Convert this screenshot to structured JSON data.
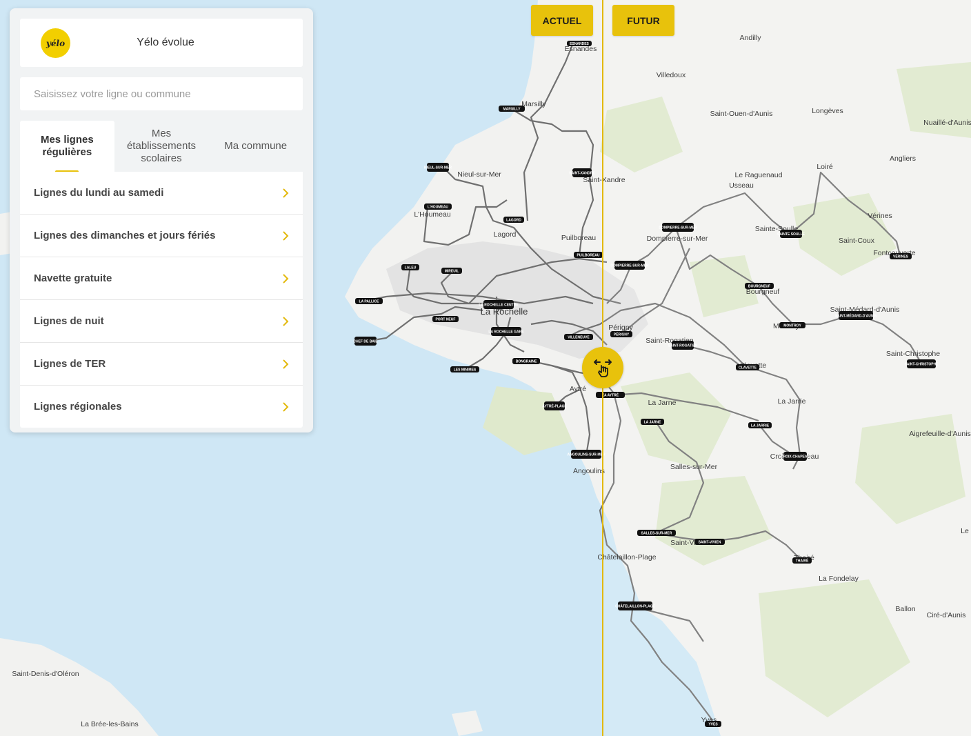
{
  "panel": {
    "logo_text": "yélo",
    "title": "Yélo évolue",
    "search": {
      "placeholder": "Saisissez votre ligne ou commune",
      "value": ""
    },
    "tabs": [
      {
        "label": "Mes lignes régulières",
        "active": true
      },
      {
        "label": "Mes établissements scolaires",
        "active": false
      },
      {
        "label": "Ma commune",
        "active": false
      }
    ],
    "menu": [
      {
        "label": "Lignes du lundi au samedi"
      },
      {
        "label": "Lignes des dimanches et jours fériés"
      },
      {
        "label": "Navette gratuite"
      },
      {
        "label": "Lignes de nuit"
      },
      {
        "label": "Lignes de TER"
      },
      {
        "label": "Lignes régionales"
      }
    ]
  },
  "compare": {
    "left_label": "ACTUEL",
    "right_label": "FUTUR"
  },
  "colors": {
    "accent": "#e8c20c",
    "sea": "#cfe7f5",
    "land": "#f2f2f0",
    "route": "#6e6e6e"
  },
  "map": {
    "place_labels": [
      "Esnandes",
      "Marsilly",
      "Nieul-sur-Mer",
      "L'Houmeau",
      "Lagord",
      "Puilboreau",
      "Saint-Xandre",
      "Villedoux",
      "Andilly",
      "Saint-Ouen-d'Aunis",
      "Longèves",
      "Nuaillé-d'Aunis",
      "Angliers",
      "Le Raguenaud",
      "Usseau",
      "Loiré",
      "Vérines",
      "Sainte-Soulle",
      "Saint-Coux",
      "Fontcouverte",
      "Dompierre-sur-Mer",
      "Bourgneuf",
      "Montroy",
      "Saint-Médard-d'Aunis",
      "Saint-Christophe",
      "La Rochelle",
      "Périgny",
      "Saint-Rogatien",
      "Clavette",
      "La Jarrie",
      "Aytré",
      "La Jarne",
      "Aigrefeuille-d'Aunis",
      "Croix-Chapeau",
      "Angoulins",
      "Salles-sur-Mer",
      "Saint-Vivien",
      "Châtelaillon-Plage",
      "Thairé",
      "La Fondelay",
      "Ballon",
      "Ciré-d'Aunis",
      "Yves",
      "Saint-Denis-d'Oléron",
      "La Brée-les-Bains",
      "Le"
    ],
    "stop_labels": [
      "ESNANDES",
      "MARSILLY",
      "NIEUL-SUR-MER",
      "SAINT-XANDRE",
      "L'HOUMEAU",
      "LAGORD",
      "LALEU",
      "MIREUIL",
      "LA PALLICE",
      "PORT NEUF",
      "LA ROCHELLE CENTRE",
      "LA ROCHELLE GARE",
      "CHEF DE BAIE",
      "LES MINIMES",
      "BONGRAINE",
      "VILLENEUVE",
      "PUILBOREAU",
      "DOMPIERRE-SUR-MER",
      "PÉRIGNY",
      "SAINT-ROGATIEN",
      "ZA AYTRÉ",
      "AYTRÉ-PLAGE",
      "ANGOULINS-SUR-MER",
      "LA JARNE",
      "SAINTE SOULLE",
      "VÉRINES",
      "BOURGNEUF",
      "MONTROY",
      "SAINT-MÉDARD-D'AUNIS",
      "SAINT-CHRISTOPHE",
      "CLAVETTE",
      "LA JARRIE",
      "CROIX-CHAPEAU",
      "SALLES-SUR-MER",
      "SAINT-VIVIEN",
      "THAIRÉ",
      "CHÂTELAILLON-PLAGE",
      "YVES"
    ]
  }
}
